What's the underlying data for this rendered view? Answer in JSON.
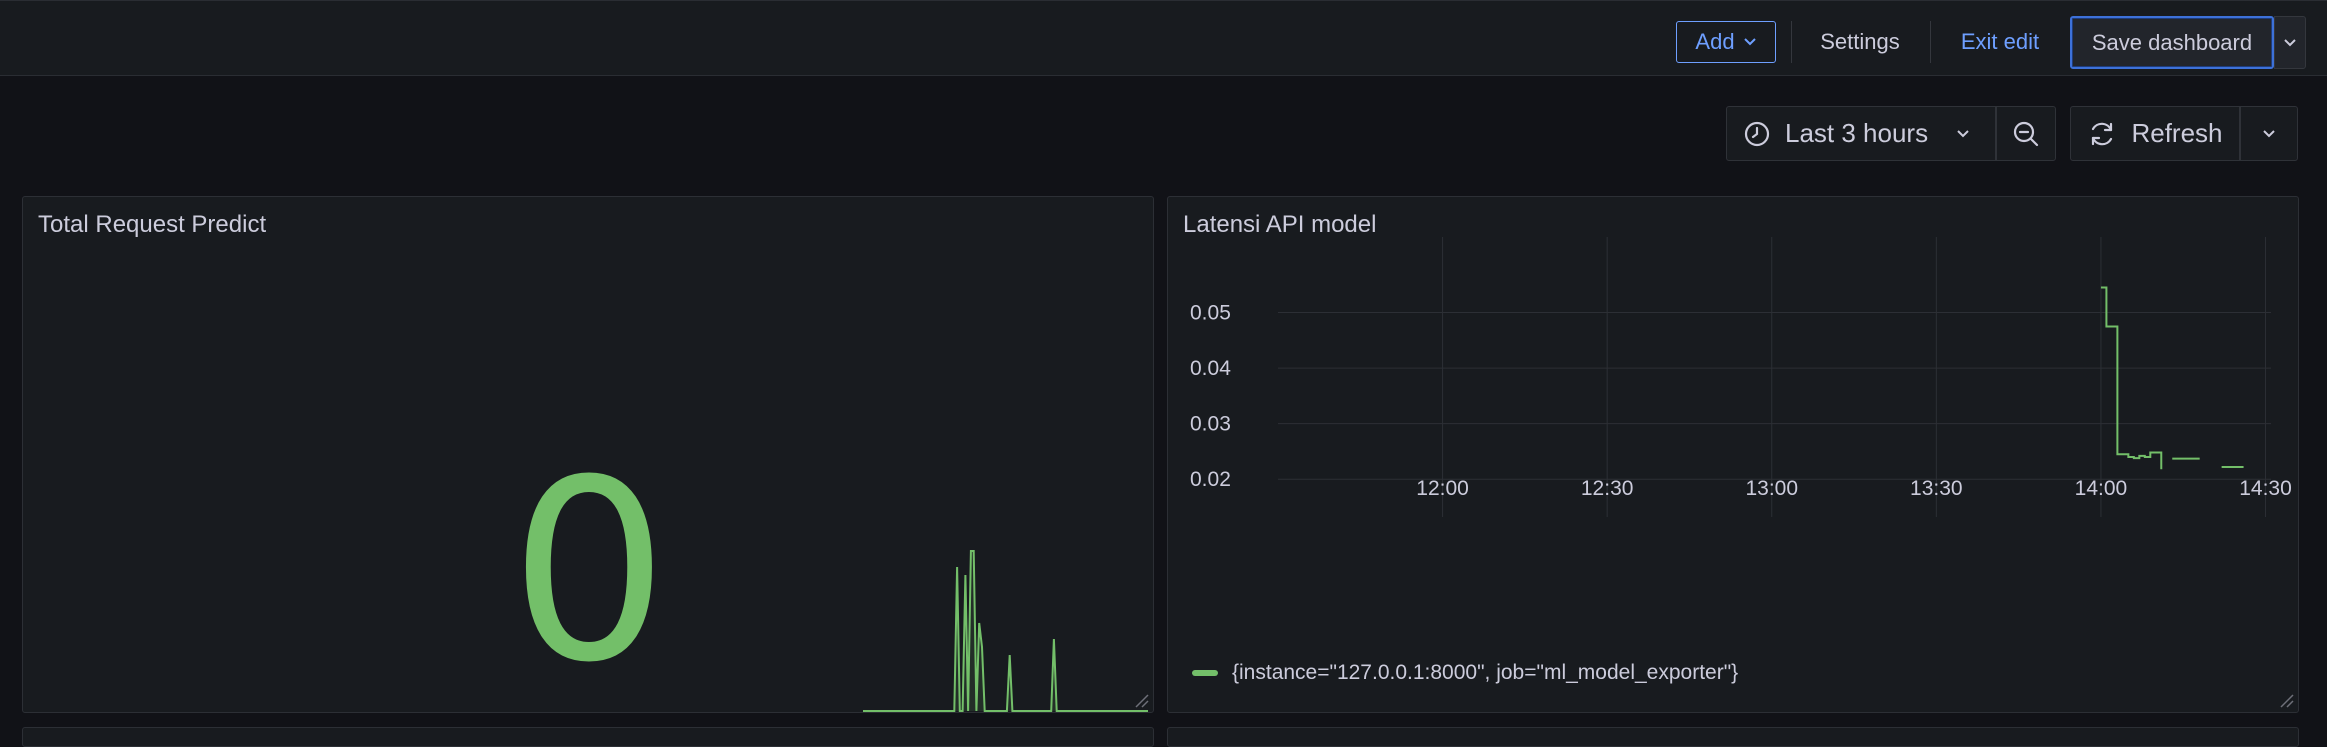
{
  "toolbar": {
    "add_label": "Add",
    "settings_label": "Settings",
    "exit_edit_label": "Exit edit",
    "save_label": "Save dashboard"
  },
  "controls": {
    "time_range": "Last 3 hours",
    "refresh_label": "Refresh"
  },
  "icons": {
    "add_caret": "chevron-down-icon",
    "save_caret": "chevron-down-icon",
    "time": "clock-icon",
    "zoom": "zoom-out-icon",
    "refresh": "refresh-icon",
    "resize": "resize-handle-icon"
  },
  "colors": {
    "accent": "#6e9fff",
    "series_green": "#73bf69",
    "panel_bg": "#181b1f",
    "page_bg": "#111217"
  },
  "panels": {
    "stat": {
      "title": "Total Request Predict",
      "value": "0"
    },
    "latency": {
      "title": "Latensi API model",
      "legend": "{instance=\"127.0.0.1:8000\", job=\"ml_model_exporter\"}"
    }
  },
  "chart_data": [
    {
      "type": "line",
      "title": "Latensi API model",
      "x_ticks": [
        "12:00",
        "12:30",
        "13:00",
        "13:30",
        "14:00",
        "14:30"
      ],
      "y_ticks": [
        "0.02",
        "0.03",
        "0.04",
        "0.05"
      ],
      "ylim": [
        0.015,
        0.06
      ],
      "xlim": [
        "11:30",
        "14:31"
      ],
      "grid": true,
      "legend": "bottom-left",
      "series": [
        {
          "name": "{instance=\"127.0.0.1:8000\", job=\"ml_model_exporter\"}",
          "color": "#73bf69",
          "segments": [
            [
              [
                "14:00",
                0.0545
              ],
              [
                "14:01",
                0.0475
              ],
              [
                "14:02",
                0.0475
              ],
              [
                "14:03",
                0.0245
              ],
              [
                "14:04",
                0.0245
              ],
              [
                "14:05",
                0.024
              ],
              [
                "14:06",
                0.0238
              ],
              [
                "14:07",
                0.0242
              ],
              [
                "14:08",
                0.024
              ],
              [
                "14:09",
                0.0248
              ],
              [
                "14:10",
                0.0248
              ],
              [
                "14:11",
                0.0218
              ]
            ],
            [
              [
                "14:13",
                0.0237
              ],
              [
                "14:18",
                0.0237
              ]
            ],
            [
              [
                "14:22",
                0.0222
              ],
              [
                "14:26",
                0.0222
              ]
            ]
          ]
        }
      ]
    },
    {
      "type": "area",
      "title": "Total Request Predict",
      "sparkline": true,
      "series": [
        {
          "color": "#73bf69",
          "values": [
            0,
            0,
            0,
            0,
            0,
            0,
            0,
            0,
            0,
            0,
            0,
            0,
            0,
            0,
            0,
            0,
            0,
            0,
            0,
            0,
            0,
            0,
            0,
            0,
            0,
            0,
            0,
            0,
            0,
            0,
            0,
            0,
            0,
            0,
            0.9,
            0,
            0,
            0.85,
            0,
            1,
            1,
            0,
            0.55,
            0.4,
            0,
            0,
            0,
            0,
            0,
            0,
            0,
            0,
            0,
            0.35,
            0,
            0,
            0,
            0,
            0,
            0,
            0,
            0,
            0,
            0,
            0,
            0,
            0,
            0,
            0,
            0.45,
            0,
            0,
            0,
            0,
            0,
            0,
            0,
            0,
            0,
            0,
            0,
            0,
            0,
            0,
            0,
            0,
            0,
            0,
            0,
            0,
            0,
            0,
            0,
            0,
            0,
            0,
            0,
            0,
            0,
            0,
            0,
            0,
            0,
            0
          ]
        }
      ]
    }
  ]
}
